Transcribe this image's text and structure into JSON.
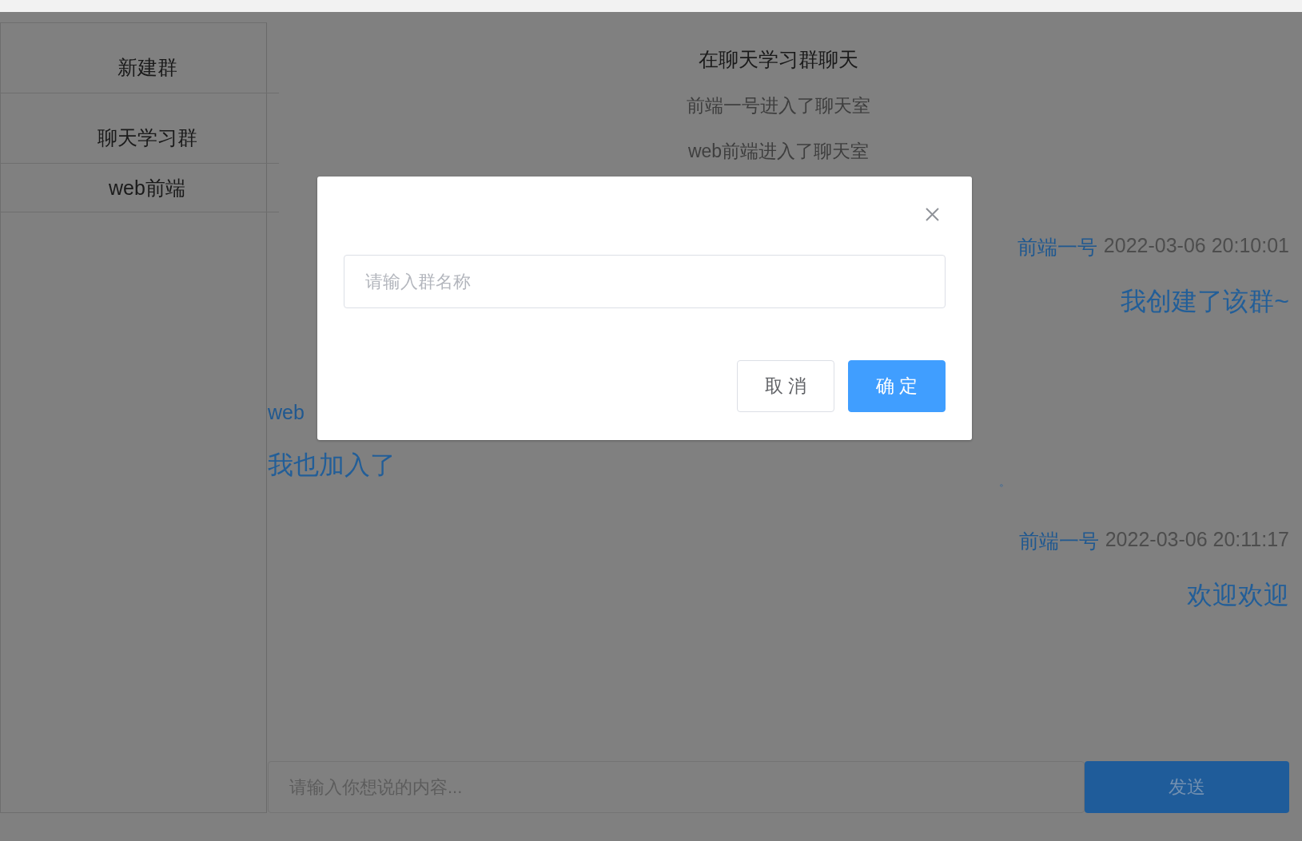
{
  "sidebar": {
    "items": [
      {
        "label": "新建群"
      },
      {
        "label": "聊天学习群"
      },
      {
        "label": "web前端"
      }
    ]
  },
  "chat": {
    "title": "在聊天学习群聊天",
    "messages": [
      {
        "kind": "system",
        "text": "前端一号进入了聊天室"
      },
      {
        "kind": "system",
        "text": "web前端进入了聊天室"
      },
      {
        "kind": "self",
        "name": "前端一号",
        "time": "2022-03-06 20:10:01",
        "text": "我创建了该群~"
      },
      {
        "kind": "other",
        "name": "web",
        "text": "我也加入了"
      },
      {
        "kind": "dot",
        "text": "。"
      },
      {
        "kind": "self",
        "name": "前端一号",
        "time": "2022-03-06 20:11:17",
        "text": "欢迎欢迎"
      }
    ],
    "input": {
      "placeholder": "请输入你想说的内容..."
    },
    "send_button": "发送"
  },
  "dialog": {
    "input": {
      "placeholder": "请输入群名称"
    },
    "buttons": [
      {
        "label": "取 消",
        "kind": "default"
      },
      {
        "label": "确 定",
        "kind": "primary"
      }
    ]
  }
}
